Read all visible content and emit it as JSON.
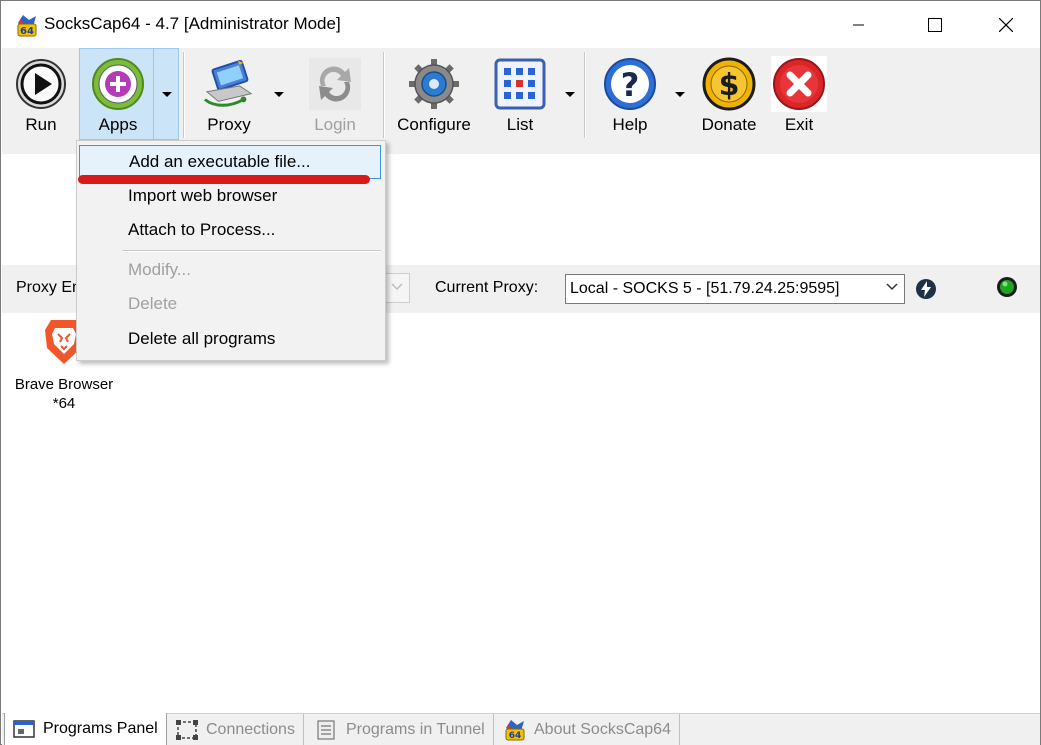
{
  "window": {
    "title": "SocksCap64 - 4.7 [Administrator Mode]",
    "app_icon": "sockscap64-logo-icon",
    "controls": [
      "minimize-icon",
      "maximize-icon",
      "close-icon"
    ]
  },
  "toolbar": {
    "run_label": "Run",
    "apps_label": "Apps",
    "proxy_label": "Proxy",
    "login_label": "Login",
    "configure_label": "Configure",
    "list_label": "List",
    "help_label": "Help",
    "donate_label": "Donate",
    "exit_label": "Exit"
  },
  "apps_menu": {
    "items": [
      {
        "label": "Add an executable file...",
        "enabled": true,
        "highlighted": true
      },
      {
        "label": "Import web browser",
        "enabled": true
      },
      {
        "label": "Attach to Process...",
        "enabled": true
      },
      {
        "label": "Modify...",
        "enabled": false
      },
      {
        "label": "Delete",
        "enabled": false
      },
      {
        "label": "Delete all programs",
        "enabled": true
      }
    ]
  },
  "proxybar": {
    "proxy_engine_label": "Proxy En",
    "current_proxy_label": "Current Proxy:",
    "current_proxy_value": "Local - SOCKS 5 - [51.79.24.25:9595]"
  },
  "programs": [
    {
      "name": "Brave Browser",
      "arch": "*64",
      "icon": "brave-lion-icon"
    }
  ],
  "tabs": [
    {
      "label": "Programs Panel",
      "active": true
    },
    {
      "label": "Connections",
      "active": false
    },
    {
      "label": "Programs in Tunnel",
      "active": false
    },
    {
      "label": "About SocksCap64",
      "active": false
    }
  ],
  "colors": {
    "menu_highlight": "#e5f1fb",
    "menu_highlight_border": "#3c95e0",
    "annotation_underline": "#d91a1a",
    "apps_button_highlight": "#cce4f7"
  }
}
